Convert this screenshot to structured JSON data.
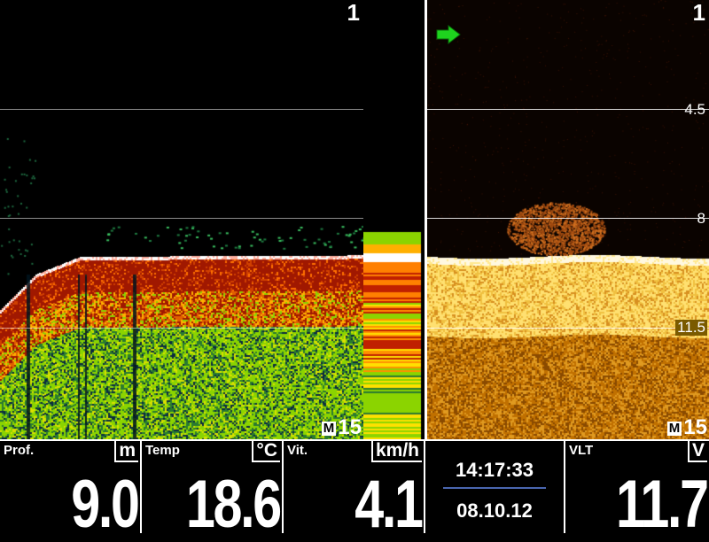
{
  "left_pane": {
    "range_top": "1",
    "range_bottom": "15",
    "range_mode": "M"
  },
  "right_pane": {
    "range_top": "1",
    "range_bottom": "15",
    "range_mode": "M",
    "depth_labels": [
      "4.5",
      "8",
      "11.5"
    ]
  },
  "indicators": {
    "arrow_color": "#1ed31e",
    "arrow_icon": "arrow-right-icon"
  },
  "data_bar": {
    "depth": {
      "label": "Prof.",
      "unit": "m",
      "value": "9.0"
    },
    "temp": {
      "label": "Temp",
      "unit": "°C",
      "value": "18.6"
    },
    "speed": {
      "label": "Vit.",
      "unit": "km/h",
      "value": "4.1"
    },
    "clock": {
      "time": "14:17:33",
      "date": "08.10.12"
    },
    "voltage": {
      "label": "VLT",
      "unit": "V",
      "value": "11.7"
    }
  },
  "colors": {
    "sonar_strong": "#b01e00",
    "sonar_mid": "#8bd400",
    "sonar_weak": "#1e5a20",
    "down_imaging_bright": "#ffe070",
    "down_imaging_mid": "#c07000",
    "depth_label_box": "#7a5a00"
  }
}
